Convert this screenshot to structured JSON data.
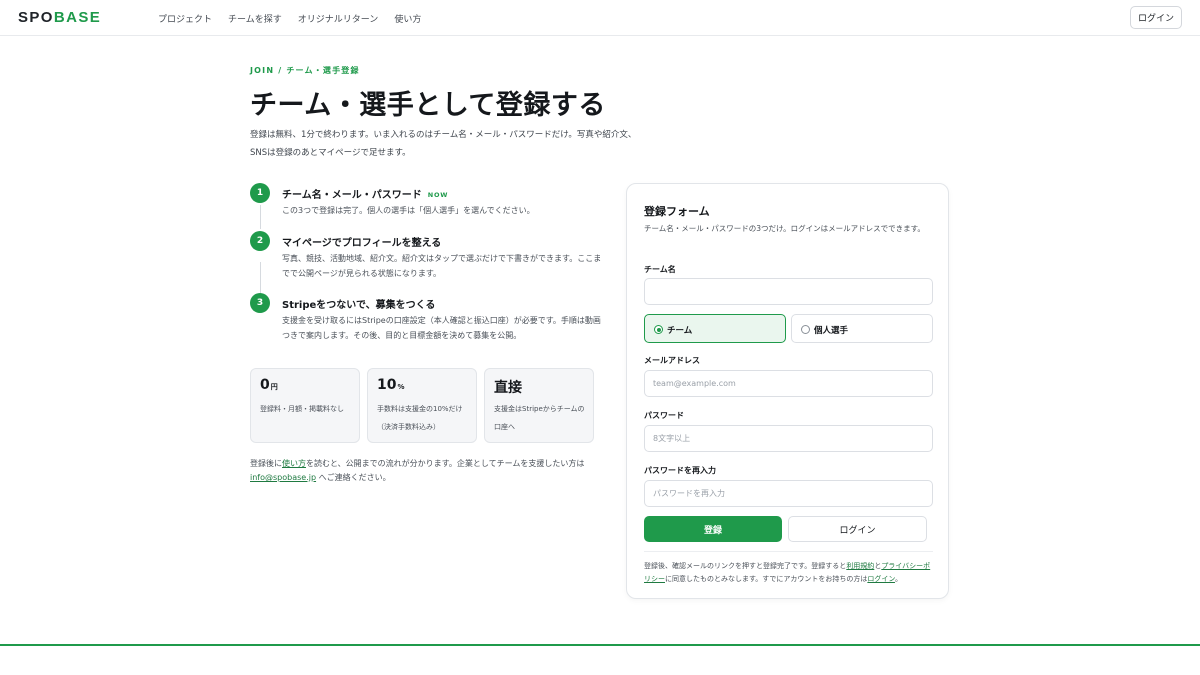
{
  "header": {
    "logo_prefix": "SPO",
    "logo_accent": "BASE",
    "nav": [
      "プロジェクト",
      "チームを探す",
      "オリジナルリターン",
      "使い方"
    ],
    "login": "ログイン"
  },
  "hero": {
    "eyebrow": "JOIN / チーム・選手登録",
    "title": "チーム・選手として登録する",
    "lead_line1": "登録は無料、1分で終わります。いま入れるのはチーム名・メール・パスワードだけ。写真や紹介文、",
    "lead_line2": "SNSは登録のあとマイページで足せます。"
  },
  "steps": [
    {
      "num": "1",
      "title": "チーム名・メール・パスワード",
      "badge": "NOW",
      "desc": "この3つで登録は完了。個人の選手は「個人選手」を選んでください。"
    },
    {
      "num": "2",
      "title": "マイページでプロフィールを整える",
      "desc": "写真、競技、活動地域、紹介文。紹介文はタップで選ぶだけで下書きができます。ここまでで公開ページが見られる状態になります。"
    },
    {
      "num": "3",
      "title": "Stripeをつないで、募集をつくる",
      "desc": "支援金を受け取るにはStripeの口座設定（本人確認と振込口座）が必要です。手順は動画つきで案内します。その後、目的と目標金額を決めて募集を公開。"
    }
  ],
  "stats": [
    {
      "value": "0",
      "unit": "円",
      "desc": "登録料・月額・掲載料なし"
    },
    {
      "value": "10",
      "unit": "%",
      "desc": "手数料は支援金の10%だけ（決済手数料込み）"
    },
    {
      "value": "直接",
      "unit": "",
      "desc": "支援金はStripeからチームの口座へ"
    }
  ],
  "note": {
    "part1": "登録後に",
    "link1": "使い方",
    "part2": "を読むと、公開までの流れが分かります。企業としてチームを支援したい方は",
    "email": "info@spobase.jp",
    "part3": " へご連絡ください。"
  },
  "form": {
    "title": "登録フォーム",
    "subtitle": "チーム名・メール・パスワードの3つだけ。ログインはメールアドレスでできます。",
    "team_label": "チーム名",
    "team_value": "",
    "type_options": [
      "チーム",
      "個人選手"
    ],
    "type_selected": "チーム",
    "email_label": "メールアドレス",
    "email_placeholder": "team@example.com",
    "password_label": "パスワード",
    "password_placeholder": "8文字以上",
    "confirm_label": "パスワードを再入力",
    "confirm_placeholder": "パスワードを再入力",
    "submit": "登録",
    "login": "ログイン",
    "footer_part1": "登録後、確認メールのリンクを押すと登録完了です。登録すると",
    "terms": "利用規約",
    "footer_and": "と",
    "privacy": "プライバシーポリシー",
    "footer_part2": "に同意したものとみなします。すでにアカウントをお持ちの方は",
    "login_link": "ログイン",
    "footer_end": "。"
  },
  "colors": {
    "accent": "#1f9a4b",
    "text": "#15181c",
    "muted": "#4a5058",
    "border": "#dcdfe4",
    "stat_bg": "#f5f6f8",
    "selected_bg": "#eaf6ee"
  }
}
